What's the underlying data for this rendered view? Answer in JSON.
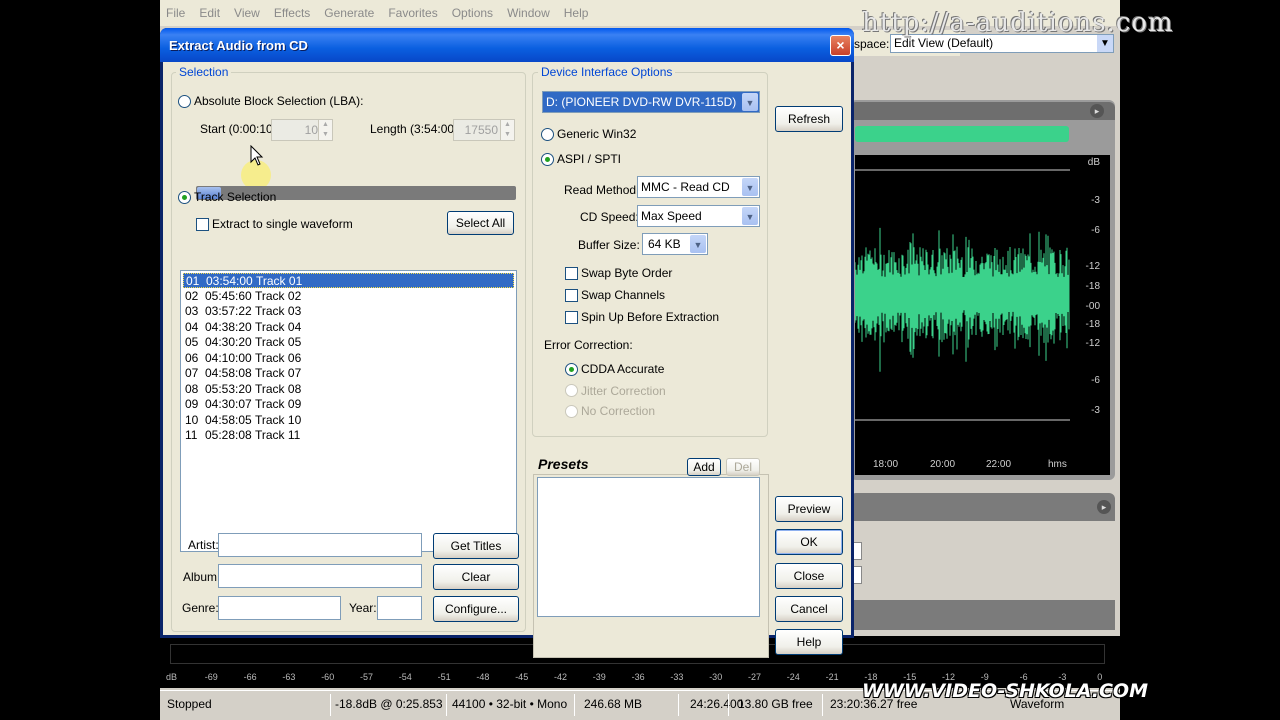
{
  "app": {
    "menu": [
      "File",
      "Edit",
      "View",
      "Effects",
      "Generate",
      "Favorites",
      "Options",
      "Window",
      "Help"
    ],
    "watermark_top": "http://a-auditions.com",
    "workspace_label": "space:",
    "workspace_value": "Edit View (Default)",
    "db_scale": [
      "dB",
      "-3",
      "-6",
      "-12",
      "-18",
      "-00",
      "-18",
      "-12",
      "-6",
      "-3"
    ],
    "time_scale": [
      "18:00",
      "20:00",
      "22:00",
      "hms"
    ],
    "level_ticks": [
      "dB",
      "-69",
      "-66",
      "-63",
      "-60",
      "-57",
      "-54",
      "-51",
      "-48",
      "-45",
      "-42",
      "-39",
      "-36",
      "-33",
      "-30",
      "-27",
      "-24",
      "-21",
      "-18",
      "-15",
      "-12",
      "-9",
      "-6",
      "-3",
      "0"
    ],
    "status": {
      "state": "Stopped",
      "level": "-18.8dB @  0:25.853",
      "format": "44100 • 32-bit • Mono",
      "size": "246.68 MB",
      "duration": "24:26.400",
      "free": "13.80 GB free",
      "time2": "23:20:36.27 free",
      "view": "Waveform"
    },
    "watermark_bottom": "WWW.VIDEO-SHKOLA.COM",
    "colors": {
      "waveform": "#3bd28b",
      "titlebar": "#0a5fe0"
    }
  },
  "dialog": {
    "title": "Extract Audio from CD",
    "close_icon": "×",
    "selection": {
      "label": "Selection",
      "absolute_block": "Absolute Block Selection (LBA):",
      "start_label": "Start (0:00:10):",
      "start_value": "10",
      "length_label": "Length (3:54:00):",
      "length_value": "17550",
      "track_selection": "Track Selection",
      "extract_single": "Extract to single waveform",
      "select_all": "Select All"
    },
    "tracks": [
      {
        "num": "01",
        "time": "03:54:00",
        "name": "Track 01"
      },
      {
        "num": "02",
        "time": "05:45:60",
        "name": "Track 02"
      },
      {
        "num": "03",
        "time": "03:57:22",
        "name": "Track 03"
      },
      {
        "num": "04",
        "time": "04:38:20",
        "name": "Track 04"
      },
      {
        "num": "05",
        "time": "04:30:20",
        "name": "Track 05"
      },
      {
        "num": "06",
        "time": "04:10:00",
        "name": "Track 06"
      },
      {
        "num": "07",
        "time": "04:58:08",
        "name": "Track 07"
      },
      {
        "num": "08",
        "time": "05:53:20",
        "name": "Track 08"
      },
      {
        "num": "09",
        "time": "04:30:07",
        "name": "Track 09"
      },
      {
        "num": "10",
        "time": "04:58:05",
        "name": "Track 10"
      },
      {
        "num": "11",
        "time": "05:28:08",
        "name": "Track 11"
      }
    ],
    "metadata": {
      "artist_label": "Artist:",
      "album_label": "Album:",
      "genre_label": "Genre:",
      "year_label": "Year:",
      "get_titles": "Get Titles",
      "clear": "Clear",
      "configure": "Configure..."
    },
    "device": {
      "label": "Device Interface Options",
      "drive": "D: (PIONEER DVD-RW  DVR-115D)",
      "generic_win32": "Generic Win32",
      "aspi": "ASPI / SPTI",
      "read_method_label": "Read Method:",
      "read_method": "MMC - Read CD",
      "cd_speed_label": "CD Speed:",
      "cd_speed": "Max Speed",
      "buffer_label": "Buffer Size:",
      "buffer": "64 KB",
      "swap_bytes": "Swap Byte Order",
      "swap_channels": "Swap Channels",
      "spin_up": "Spin Up Before Extraction",
      "error_label": "Error Correction:",
      "cdda": "CDDA Accurate",
      "jitter": "Jitter Correction",
      "no_correction": "No Correction"
    },
    "presets": {
      "label": "Presets",
      "add": "Add",
      "del": "Del"
    },
    "buttons": {
      "refresh": "Refresh",
      "preview": "Preview",
      "ok": "OK",
      "close": "Close",
      "cancel": "Cancel",
      "help": "Help"
    }
  }
}
